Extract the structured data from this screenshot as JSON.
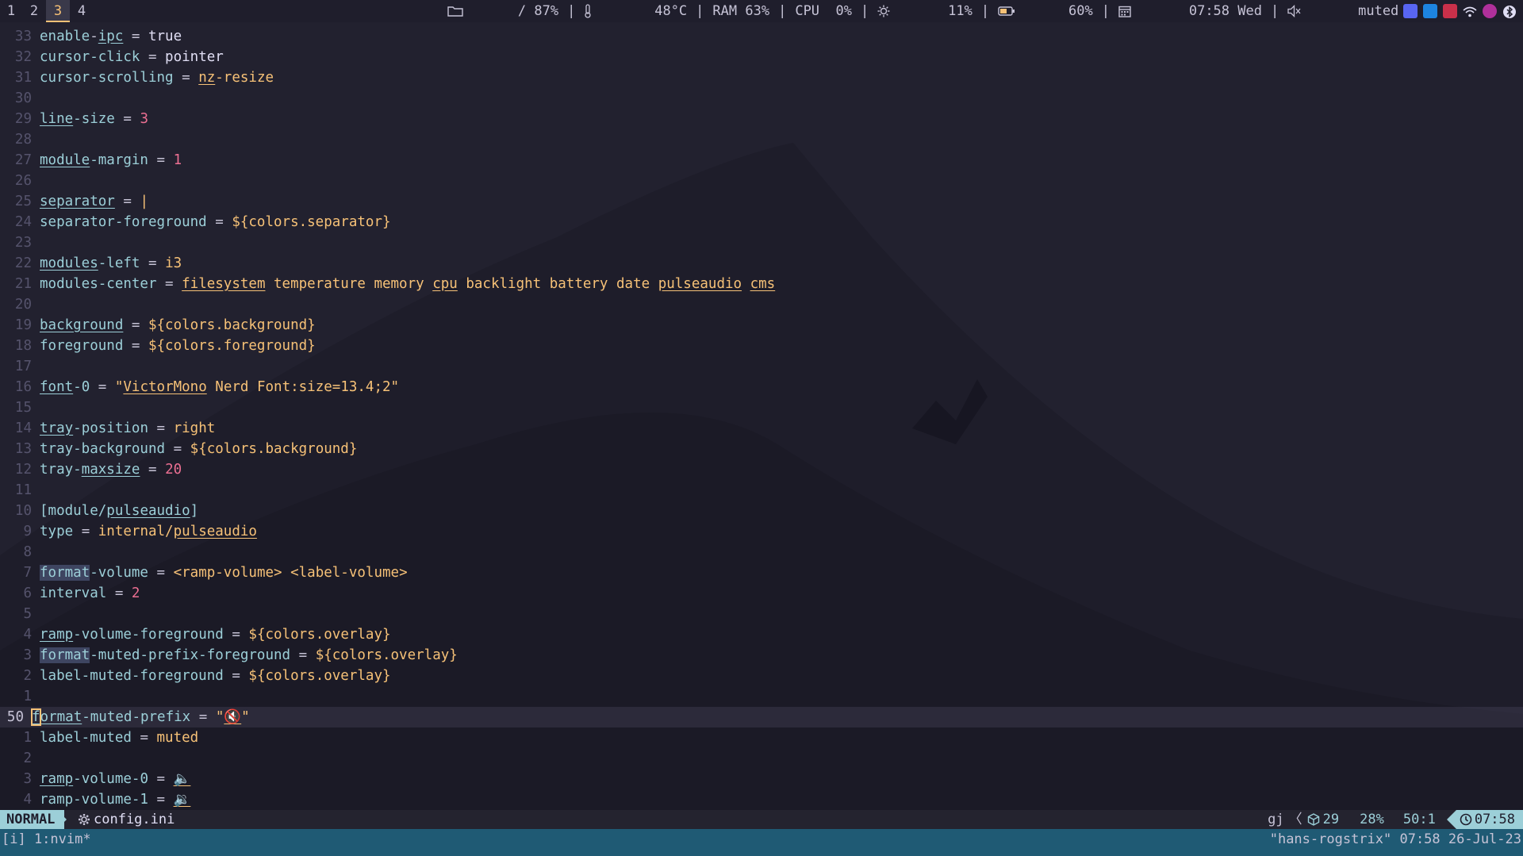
{
  "topbar": {
    "workspaces": [
      "1",
      "2",
      "3",
      "4"
    ],
    "active_workspace": "3",
    "filesystem": "/ 87%",
    "temperature": "48°C",
    "memory": "RAM 63%",
    "cpu": "CPU  0%",
    "backlight": "11%",
    "battery": "60%",
    "date": "07:58 Wed",
    "volume": "muted",
    "separator": "|",
    "icons": {
      "filesystem": "folder-icon",
      "temperature": "thermometer-icon",
      "backlight": "sun-icon",
      "battery": "battery-icon",
      "date": "calendar-icon",
      "volume": "speaker-muted-icon"
    }
  },
  "editor": {
    "lines": [
      {
        "n": "33",
        "html": "<span class='k'>enable</span>-<span class='k u'>ipc</span> = <span class='v'>true</span>"
      },
      {
        "n": "32",
        "html": "<span class='k'>cursor-click</span> = <span class='v'>pointer</span>"
      },
      {
        "n": "31",
        "html": "<span class='k'>cursor-scrolling</span> = <span class='str u'>nz</span><span class='str'>-resize</span>"
      },
      {
        "n": "30",
        "html": ""
      },
      {
        "n": "29",
        "html": "<span class='k u'>line</span><span class='k'>-size</span> = <span class='num'>3</span>"
      },
      {
        "n": "28",
        "html": ""
      },
      {
        "n": "27",
        "html": "<span class='k u'>module</span><span class='k'>-margin</span> = <span class='num'>1</span>"
      },
      {
        "n": "26",
        "html": ""
      },
      {
        "n": "25",
        "html": "<span class='k u'>separator</span> = <span class='str'>|</span>"
      },
      {
        "n": "24",
        "html": "<span class='k'>separator-foreground</span> = <span class='str'>${colors.separator}</span>"
      },
      {
        "n": "23",
        "html": ""
      },
      {
        "n": "22",
        "html": "<span class='k u'>modules</span><span class='k'>-left</span> = <span class='str'>i3</span>"
      },
      {
        "n": "21",
        "html": "<span class='k'>modules-center</span> = <span class='str u'>filesystem</span><span class='str'> temperature memory </span><span class='str u'>cpu</span><span class='str'> backlight battery date </span><span class='str u'>pulseaudio</span> <span class='str u'>cms</span>"
      },
      {
        "n": "20",
        "html": ""
      },
      {
        "n": "19",
        "html": "<span class='k u'>background</span> = <span class='str'>${colors.background}</span>"
      },
      {
        "n": "18",
        "html": "<span class='k'>foreground</span> = <span class='str'>${colors.foreground}</span>"
      },
      {
        "n": "17",
        "html": ""
      },
      {
        "n": "16",
        "html": "<span class='k u'>font</span><span class='k'>-0</span> = <span class='str'>\"</span><span class='str u'>VictorMono</span><span class='str'> Nerd Font:size=13.4;2\"</span>"
      },
      {
        "n": "15",
        "html": ""
      },
      {
        "n": "14",
        "html": "<span class='k u'>tray</span><span class='k'>-position</span> = <span class='str'>right</span>"
      },
      {
        "n": "13",
        "html": "<span class='k'>tray-background</span> = <span class='str'>${colors.background}</span>"
      },
      {
        "n": "12",
        "html": "<span class='k'>tray-</span><span class='k u'>maxsize</span> = <span class='num'>20</span>"
      },
      {
        "n": "11",
        "html": ""
      },
      {
        "n": "10",
        "html": "<span class='k'>[module/</span><span class='k u'>pulseaudio</span><span class='k'>]</span>"
      },
      {
        "n": "9",
        "html": "<span class='k'>type</span> = <span class='str'>internal/</span><span class='str u'>pulseaudio</span>"
      },
      {
        "n": "8",
        "html": ""
      },
      {
        "n": "7",
        "html": "<span class='k hl'>format</span><span class='k'>-volume</span> = <span class='str'>&lt;ramp-volume&gt; &lt;label-volume&gt;</span>"
      },
      {
        "n": "6",
        "html": "<span class='k'>interval</span> = <span class='num'>2</span>"
      },
      {
        "n": "5",
        "html": ""
      },
      {
        "n": "4",
        "html": "<span class='k u'>ramp</span><span class='k'>-volume-foreground</span> = <span class='str'>${colors.overlay}</span>"
      },
      {
        "n": "3",
        "html": "<span class='k hl'>format</span><span class='k'>-muted-prefix-foreground</span> = <span class='str'>${colors.overlay}</span>"
      },
      {
        "n": "2",
        "html": "<span class='k'>label-muted-foreground</span> = <span class='str'>${colors.overlay}</span>"
      },
      {
        "n": "1",
        "html": ""
      },
      {
        "n": "50",
        "current": true,
        "html": "<span class='k u cursor'>f</span><span class='k u'>ormat</span><span class='k'>-muted-prefix</span> = <span class='str'>\"</span><span class='str u'>🔇</span><span class='str'>\"</span>"
      },
      {
        "n": "1",
        "html": "<span class='k'>label-muted</span> = <span class='str'>muted</span>"
      },
      {
        "n": "2",
        "html": ""
      },
      {
        "n": "3",
        "html": "<span class='k u'>ramp</span><span class='k'>-volume-0</span> = <span class='str u'>🔈</span>"
      },
      {
        "n": "4",
        "html": "<span class='k'>ramp-volume-1</span> = <span class='str u'>🔉</span>"
      }
    ]
  },
  "statusline": {
    "mode": "NORMAL",
    "filename": "config.ini",
    "keys": "gj",
    "chevron": "〈",
    "count": "29",
    "percent": "28%",
    "position": "50:1",
    "clock": "07:58",
    "icons": {
      "file": "gear-icon",
      "count": "package-icon",
      "clock": "clock-icon"
    }
  },
  "tmux": {
    "left": "[i] 1:nvim*",
    "right": "\"hans-rogstrix\" 07:58 26-Jul-23"
  },
  "colors": {
    "accent": "#9ccfd8",
    "workspace_active": "#f6c177",
    "number": "#eb6f92",
    "string": "#f6c177",
    "tmux_bar": "#1f5a74",
    "background": "#22212f"
  }
}
